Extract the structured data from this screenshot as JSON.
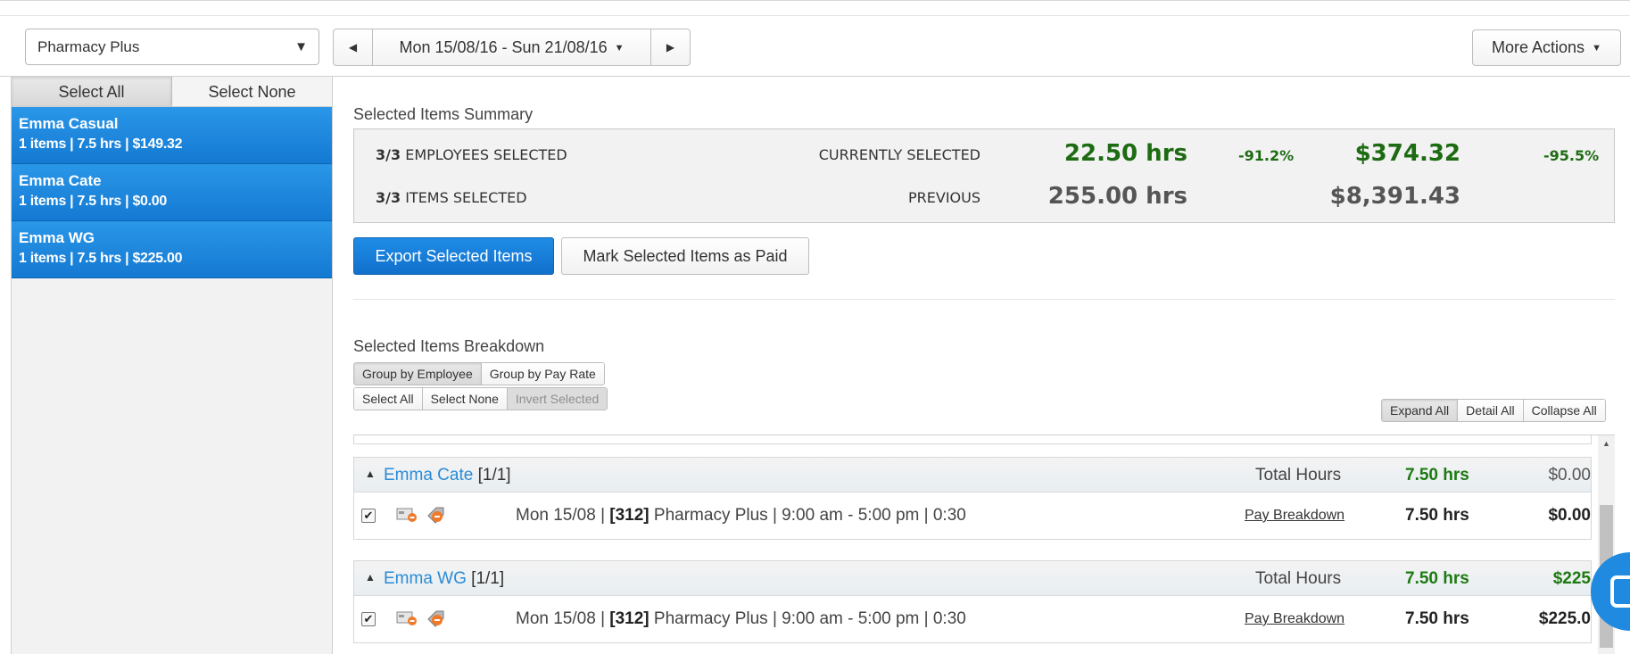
{
  "header": {
    "location": "Pharmacy Plus",
    "date_range": "Mon 15/08/16 - Sun 21/08/16",
    "more_actions": "More Actions"
  },
  "sidebar": {
    "select_all": "Select All",
    "select_none": "Select None",
    "employees": [
      {
        "name": "Emma Casual",
        "summary": "1 items | 7.5 hrs | $149.32"
      },
      {
        "name": "Emma Cate",
        "summary": "1 items | 7.5 hrs | $0.00"
      },
      {
        "name": "Emma WG",
        "summary": "1 items | 7.5 hrs | $225.00"
      }
    ]
  },
  "summary": {
    "title": "Selected Items Summary",
    "employees_count": "3/3",
    "employees_label": "EMPLOYEES SELECTED",
    "items_count": "3/3",
    "items_label": "ITEMS SELECTED",
    "current_label": "CURRENTLY SELECTED",
    "previous_label": "PREVIOUS",
    "current_hours": "22.50 hrs",
    "hours_change": "-91.2%",
    "current_amount": "$374.32",
    "amount_change": "-95.5%",
    "previous_hours": "255.00 hrs",
    "previous_amount": "$8,391.43"
  },
  "actions": {
    "export": "Export Selected Items",
    "mark_paid": "Mark Selected Items as Paid"
  },
  "breakdown": {
    "title": "Selected Items Breakdown",
    "group_by_employee": "Group by Employee",
    "group_by_pay_rate": "Group by Pay Rate",
    "select_all": "Select All",
    "select_none": "Select None",
    "invert_selected": "Invert Selected",
    "expand_all": "Expand All",
    "detail_all": "Detail All",
    "collapse_all": "Collapse All",
    "groups": [
      {
        "name": "Emma Cate",
        "count": "[1/1]",
        "total_label": "Total Hours",
        "total_hours": "7.50 hrs",
        "total_amount": "$0.00",
        "row_date": "Mon 15/08 | ",
        "row_code": "[312]",
        "row_rest": " Pharmacy Plus | 9:00 am - 5:00 pm | 0:30",
        "pay_breakdown": "Pay Breakdown",
        "row_hours": "7.50 hrs",
        "row_amount": "$0.00"
      },
      {
        "name": "Emma WG",
        "count": "[1/1]",
        "total_label": "Total Hours",
        "total_hours": "7.50 hrs",
        "total_amount": "$225",
        "row_date": "Mon 15/08 | ",
        "row_code": "[312]",
        "row_rest": " Pharmacy Plus | 9:00 am - 5:00 pm | 0:30",
        "pay_breakdown": "Pay Breakdown",
        "row_hours": "7.50 hrs",
        "row_amount": "$225.0"
      }
    ]
  },
  "colors": {
    "primary": "#1479d2",
    "positive": "#1d6b12",
    "link": "#2a8bd6"
  }
}
